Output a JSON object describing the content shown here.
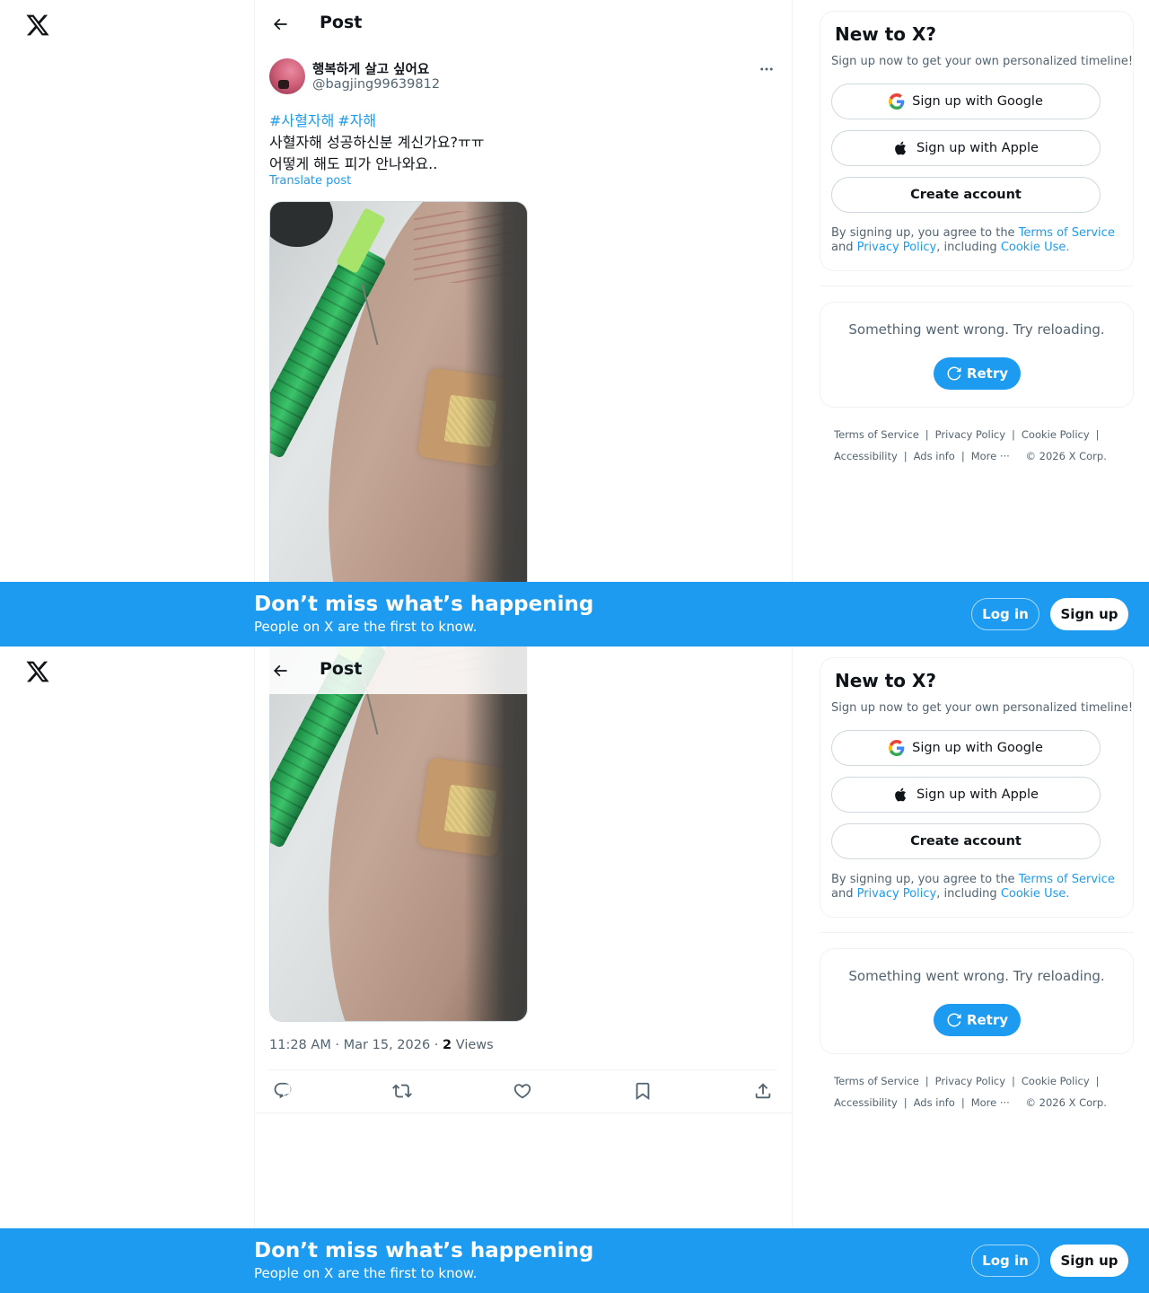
{
  "app": {
    "logo": "x-logo-icon"
  },
  "topbar": {
    "title": "Post",
    "back_icon": "arrow-left-icon"
  },
  "post": {
    "display_name": "행복하게 살고 싶어요",
    "handle": "@bagjing99639812",
    "hashtags": [
      "#사혈자해",
      "#자해"
    ],
    "text_lines": [
      "사혈자해 성공하신분 계신가요?ㅠㅠ",
      "어떻게 해도 피가 안나와요.."
    ],
    "translate_label": "Translate post",
    "timestamp": "11:28 AM · Mar 15, 2026 · ",
    "views_count": "2",
    "views_label": " Views",
    "actions": [
      "reply-icon",
      "repost-icon",
      "like-icon",
      "bookmark-icon",
      "share-icon"
    ]
  },
  "sidebar": {
    "signup": {
      "title": "New to X?",
      "subtitle": "Sign up now to get your own personalized timeline!",
      "google_label": "Sign up with Google",
      "apple_label": "Sign up with Apple",
      "create_label": "Create account",
      "terms_prefix": "By signing up, you agree to the ",
      "terms_link": "Terms of Service",
      "terms_and": " and ",
      "privacy_link": "Privacy Policy",
      "terms_including": ", including ",
      "cookie_link": "Cookie Use."
    },
    "error": {
      "message": "Something went wrong. Try reloading.",
      "retry_label": "Retry"
    },
    "footer": {
      "terms": "Terms of Service",
      "privacy": "Privacy Policy",
      "cookie": "Cookie Policy",
      "accessibility": "Accessibility",
      "ads": "Ads info",
      "more": "More ···",
      "copyright": "© 2026 X Corp."
    }
  },
  "banner": {
    "title": "Don’t miss what’s happening",
    "subtitle": "People on X are the first to know.",
    "login_label": "Log in",
    "signup_label": "Sign up"
  },
  "colors": {
    "accent": "#1d9bf0",
    "text": "#0f1419",
    "secondary": "#536471",
    "border": "#eff3f4"
  }
}
